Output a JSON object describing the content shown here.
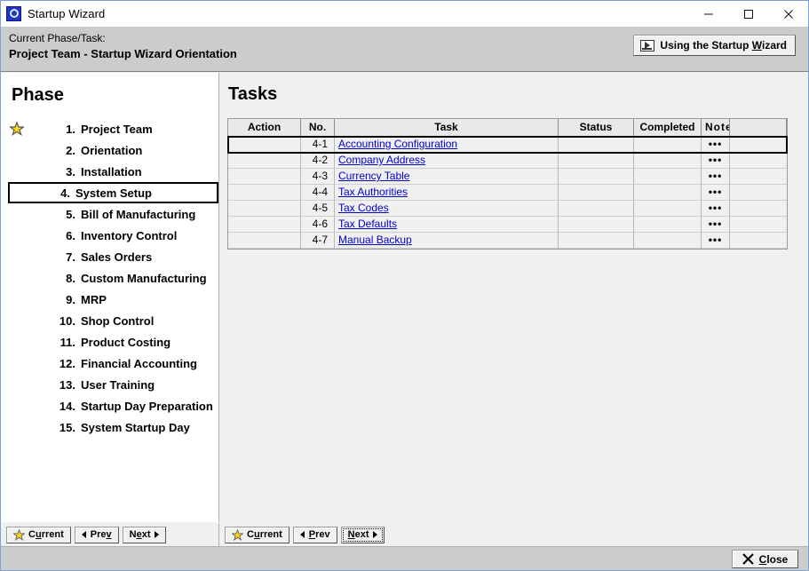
{
  "window": {
    "title": "Startup Wizard",
    "icon": "app-icon",
    "minimize": "minimize-icon",
    "maximize": "maximize-icon",
    "close": "close-icon"
  },
  "header": {
    "label": "Current Phase/Task:",
    "phase": "Project Team",
    "separator": "-",
    "task": "Startup Wizard Orientation",
    "wizard_button": {
      "text_before": "Using the Startup ",
      "accel": "W",
      "text_after": "izard",
      "icon": "video-icon"
    }
  },
  "phase_panel": {
    "heading": "Phase",
    "items": [
      {
        "num": "1.",
        "label": "Project Team",
        "star": true,
        "selected": false
      },
      {
        "num": "2.",
        "label": "Orientation",
        "star": false,
        "selected": false
      },
      {
        "num": "3.",
        "label": "Installation",
        "star": false,
        "selected": false
      },
      {
        "num": "4.",
        "label": "System Setup",
        "star": false,
        "selected": true
      },
      {
        "num": "5.",
        "label": "Bill of Manufacturing",
        "star": false,
        "selected": false
      },
      {
        "num": "6.",
        "label": "Inventory Control",
        "star": false,
        "selected": false
      },
      {
        "num": "7.",
        "label": "Sales Orders",
        "star": false,
        "selected": false
      },
      {
        "num": "8.",
        "label": "Custom Manufacturing",
        "star": false,
        "selected": false
      },
      {
        "num": "9.",
        "label": "MRP",
        "star": false,
        "selected": false
      },
      {
        "num": "10.",
        "label": "Shop Control",
        "star": false,
        "selected": false
      },
      {
        "num": "11.",
        "label": "Product Costing",
        "star": false,
        "selected": false
      },
      {
        "num": "12.",
        "label": "Financial Accounting",
        "star": false,
        "selected": false
      },
      {
        "num": "13.",
        "label": "User Training",
        "star": false,
        "selected": false
      },
      {
        "num": "14.",
        "label": "Startup Day Preparation",
        "star": false,
        "selected": false
      },
      {
        "num": "15.",
        "label": "System Startup Day",
        "star": false,
        "selected": false
      }
    ]
  },
  "tasks_panel": {
    "heading": "Tasks",
    "columns": [
      "Action",
      "No.",
      "Task",
      "Status",
      "Completed",
      "Note",
      ""
    ],
    "rows": [
      {
        "action": "",
        "no": "4-1",
        "task": "Accounting Configuration",
        "status": "",
        "completed": "",
        "note": "•••",
        "last": "",
        "selected": true
      },
      {
        "action": "",
        "no": "4-2",
        "task": "Company Address",
        "status": "",
        "completed": "",
        "note": "•••",
        "last": "",
        "selected": false
      },
      {
        "action": "",
        "no": "4-3",
        "task": "Currency Table",
        "status": "",
        "completed": "",
        "note": "•••",
        "last": "",
        "selected": false
      },
      {
        "action": "",
        "no": "4-4",
        "task": "Tax Authorities",
        "status": "",
        "completed": "",
        "note": "•••",
        "last": "",
        "selected": false
      },
      {
        "action": "",
        "no": "4-5",
        "task": "Tax Codes",
        "status": "",
        "completed": "",
        "note": "•••",
        "last": "",
        "selected": false
      },
      {
        "action": "",
        "no": "4-6",
        "task": "Tax Defaults",
        "status": "",
        "completed": "",
        "note": "•••",
        "last": "",
        "selected": false
      },
      {
        "action": "",
        "no": "4-7",
        "task": "Manual Backup",
        "status": "",
        "completed": "",
        "note": "•••",
        "last": "",
        "selected": false
      }
    ]
  },
  "phase_nav": {
    "current": {
      "before": "C",
      "accel": "u",
      "after": "rrent"
    },
    "prev": {
      "before": "Pre",
      "accel": "v",
      "after": ""
    },
    "next": {
      "before": "N",
      "accel": "e",
      "after": "xt"
    }
  },
  "task_nav": {
    "current": {
      "before": "C",
      "accel": "u",
      "after": "rrent"
    },
    "prev": {
      "before": "",
      "accel": "P",
      "after": "rev"
    },
    "next": {
      "before": "",
      "accel": "N",
      "after": "ext"
    }
  },
  "footer": {
    "close": {
      "before": "",
      "accel": "C",
      "after": "lose"
    },
    "close_icon": "x-icon"
  },
  "colors": {
    "link": "#0000cc",
    "header_strip": "#cccccc",
    "panel_bg": "#f0f0f0",
    "star": "#ffd21e",
    "titlebar": "#ffffff"
  }
}
